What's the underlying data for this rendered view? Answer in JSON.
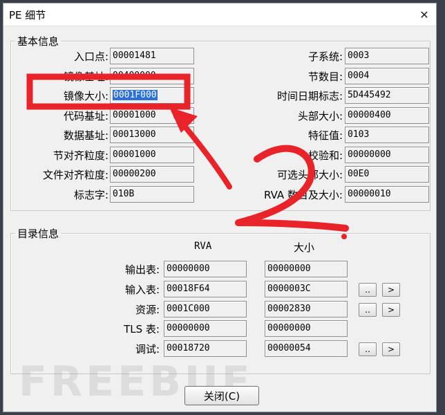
{
  "window": {
    "title": "PE 细节",
    "close_icon": "close-icon"
  },
  "basic": {
    "legend": "基本信息",
    "left": [
      {
        "label": "入口点:",
        "value": "00001481"
      },
      {
        "label": "镜像基址:",
        "value": "00400000"
      },
      {
        "label": "镜像大小:",
        "value": "0001F000"
      },
      {
        "label": "代码基址:",
        "value": "00001000"
      },
      {
        "label": "数据基址:",
        "value": "00013000"
      },
      {
        "label": "节对齐粒度:",
        "value": "00001000"
      },
      {
        "label": "文件对齐粒度:",
        "value": "00000200"
      },
      {
        "label": "标志字:",
        "value": "010B"
      }
    ],
    "right": [
      {
        "label": "子系统:",
        "value": "0003"
      },
      {
        "label": "节数目:",
        "value": "0004"
      },
      {
        "label": "时间日期标志:",
        "value": "5D445492"
      },
      {
        "label": "头部大小:",
        "value": "00000400"
      },
      {
        "label": "特征值:",
        "value": "0103"
      },
      {
        "label": "校验和:",
        "value": "00000000"
      },
      {
        "label": "可选头部大小:",
        "value": "00E0"
      },
      {
        "label": "RVA 数目及大小:",
        "value": "00000010"
      }
    ]
  },
  "directory": {
    "legend": "目录信息",
    "col_rva": "RVA",
    "col_size": "大小",
    "rows": [
      {
        "label": "输出表:",
        "rva": "00000000",
        "size": "00000000",
        "buttons": false
      },
      {
        "label": "输入表:",
        "rva": "00018F64",
        "size": "0000003C",
        "buttons": true
      },
      {
        "label": "资源:",
        "rva": "0001C000",
        "size": "00002830",
        "buttons": true
      },
      {
        "label": "TLS 表:",
        "rva": "00000000",
        "size": "00000000",
        "buttons": false
      },
      {
        "label": "调试:",
        "rva": "00018720",
        "size": "00000054",
        "buttons": true
      }
    ],
    "more_label": "..",
    "go_label": ">"
  },
  "footer": {
    "close_label": "关闭(C)"
  },
  "watermark": "FREEBUF",
  "annotation": {
    "number": "2",
    "color": "#e8232a"
  }
}
